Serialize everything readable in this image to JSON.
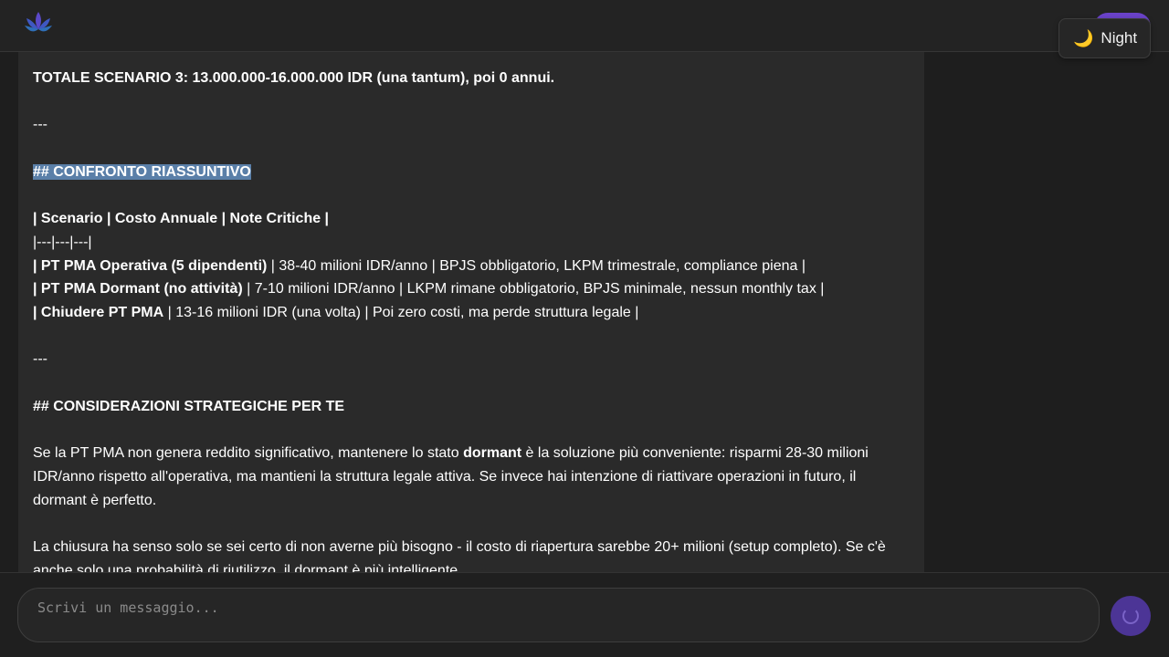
{
  "header": {
    "night_toggle": {
      "icon": "moon-icon",
      "label": "Night"
    },
    "logo": {
      "icon": "lotus-logo-icon",
      "color": "#6a4fd0"
    },
    "accent": "#6a43c9"
  },
  "message": {
    "lines": [
      {
        "text": "TOTALE SCENARIO 3: 13.000.000-16.000.000 IDR (una tantum), poi 0 annui."
      },
      {
        "text": "---"
      },
      {
        "text": "## CONFRONTO RIASSUNTIVO"
      },
      {
        "text": "| Scenario | Costo Annuale | Note Critiche |"
      },
      {
        "text": "|---|---|---|"
      },
      {
        "bold": "| PT PMA Operativa (5 dipendenti)",
        "rest": " | 38-40 milioni IDR/anno | BPJS obbligatorio, LKPM trimestrale, compliance piena |"
      },
      {
        "bold": "| PT PMA Dormant (no attività)",
        "rest": " | 7-10 milioni IDR/anno | LKPM rimane obbligatorio, BPJS minimale, nessun monthly tax |"
      },
      {
        "bold": "| Chiudere PT PMA",
        "rest": " | 13-16 milioni IDR (una volta) | Poi zero costi, ma perde struttura legale |"
      },
      {
        "text": "---"
      },
      {
        "text": "## CONSIDERAZIONI STRATEGICHE PER TE"
      },
      {
        "p1_before": "Se la PT PMA non genera reddito significativo, mantenere lo stato ",
        "p1_bold": "dormant",
        "p1_after": " è la soluzione più conveniente: risparmi 28-30 milioni IDR/anno rispetto all'operativa, ma mantieni la struttura legale attiva. Se invece hai intenzione di riattivare operazioni in futuro, il dormant è perfetto."
      },
      {
        "text": "La chiusura ha senso solo se sei certo di non averne più bisogno - il costo di riapertura sarebbe 20+ milioni (setup completo). Se c'è anche solo una probabilità di riutilizzo, il dormant è più intelligente."
      }
    ]
  },
  "composer": {
    "placeholder": "Scrivi un messaggio...",
    "send_icon": "loading-spinner-icon"
  }
}
